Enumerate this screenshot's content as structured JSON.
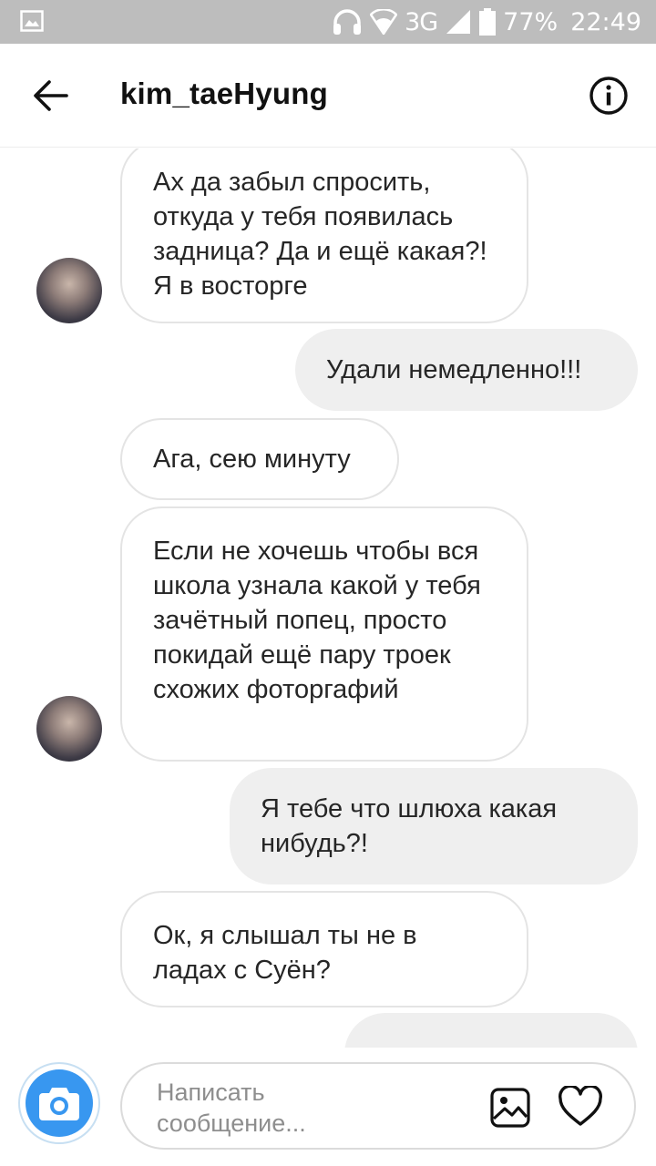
{
  "status_bar": {
    "network": "3G",
    "battery": "77%",
    "time": "22:49"
  },
  "header": {
    "title": "kim_taeHyung",
    "back_icon": "arrow-left-icon",
    "info_icon": "info-circle-icon"
  },
  "messages": [
    {
      "direction": "incoming",
      "text": "Ах да забыл спросить, откуда у тебя появилась задница? Да и ещё какая?! Я в восторге"
    },
    {
      "direction": "outgoing",
      "text": "Удали немедленно!!!"
    },
    {
      "direction": "incoming",
      "text": "Ага, сею минуту"
    },
    {
      "direction": "incoming",
      "text": "Если не хочешь чтобы вся школа узнала какой у тебя зачётный попец, просто покидай ещё пару троек схожих фоторгафий"
    },
    {
      "direction": "outgoing",
      "text": "Я тебе что шлюха какая нибудь?!"
    },
    {
      "direction": "incoming",
      "text": "Ок, я слышал ты не в ладах с Суён?"
    }
  ],
  "composer": {
    "placeholder": "Написать сообщение...",
    "camera_icon": "camera-icon",
    "gallery_icon": "gallery-icon",
    "like_icon": "heart-icon"
  },
  "colors": {
    "accent": "#3897f0",
    "status_bar": "#bdbdbd",
    "outgoing_bubble": "#efefef",
    "incoming_border": "#e4e4e4"
  }
}
